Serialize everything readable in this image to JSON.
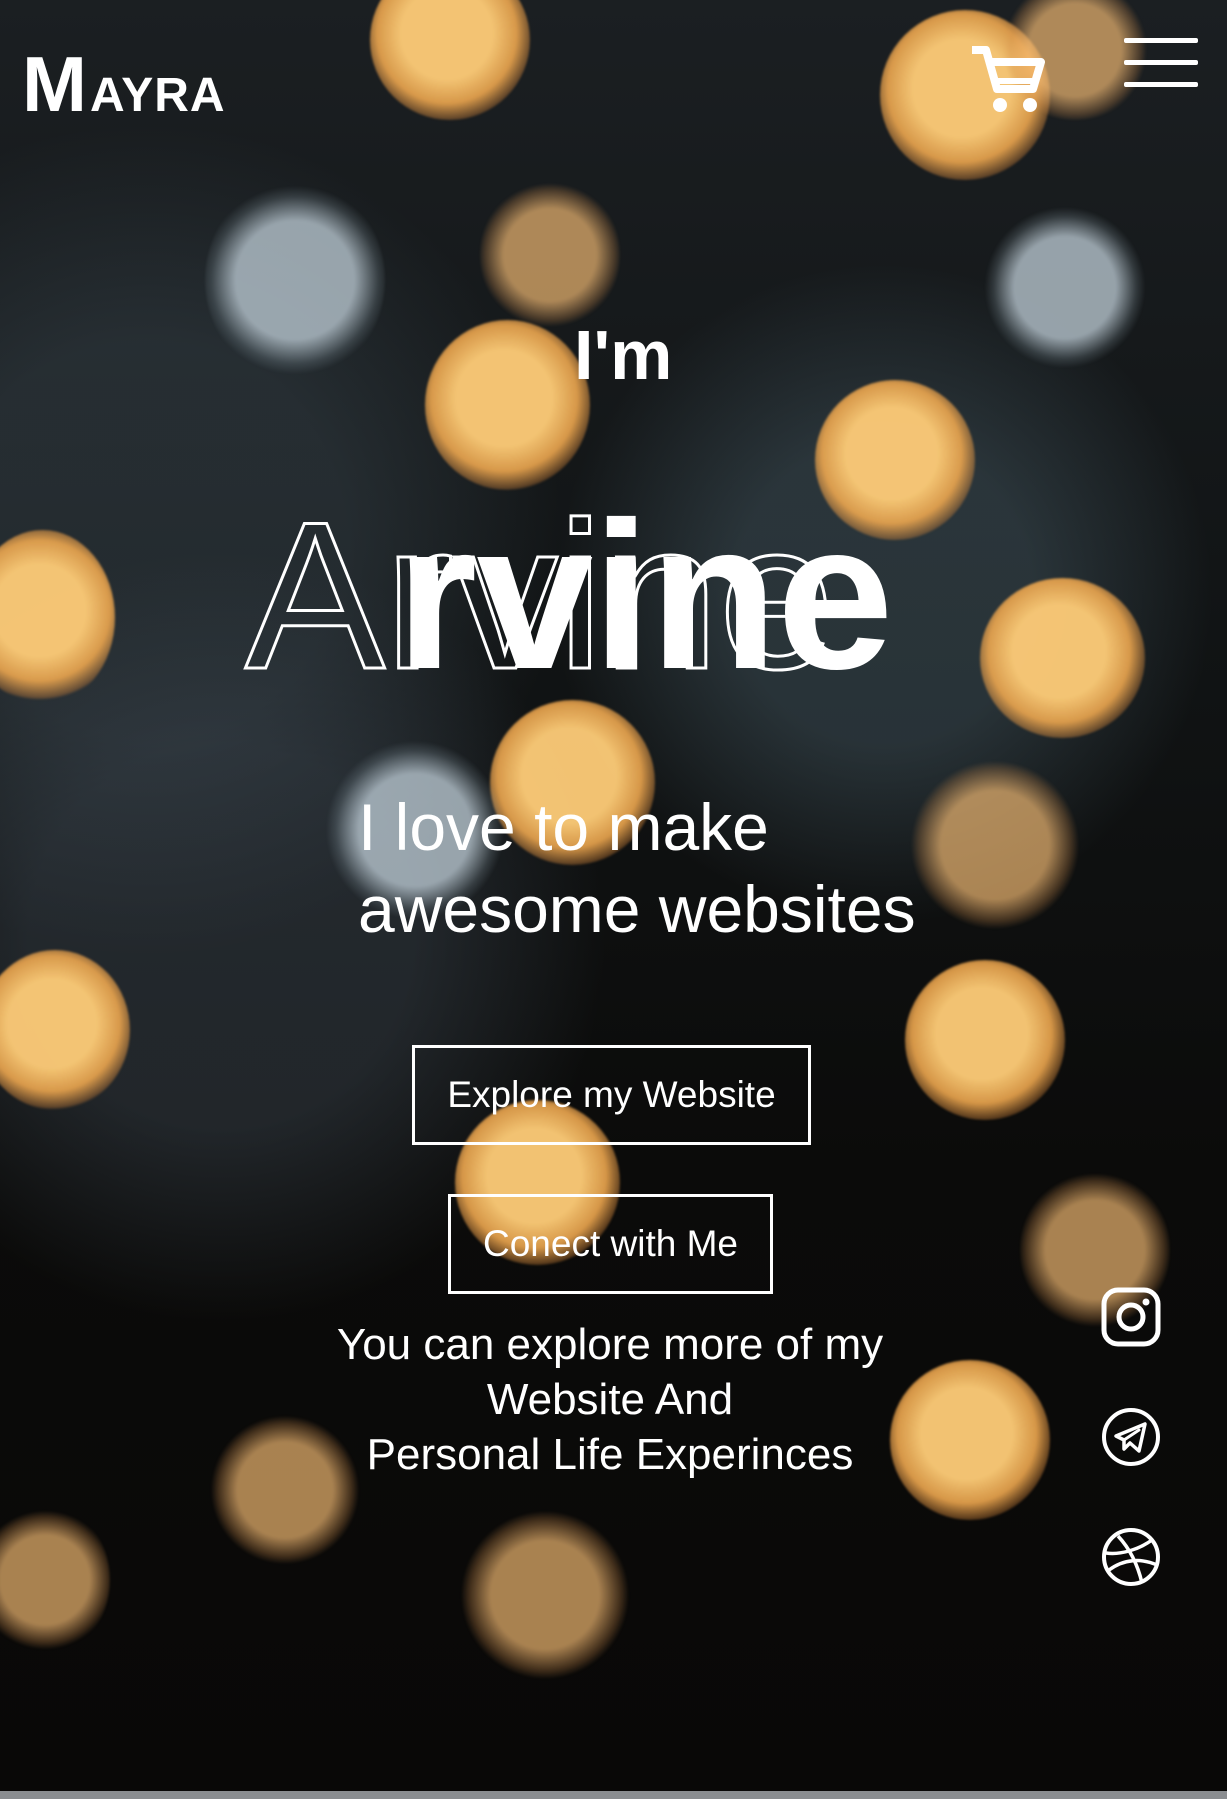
{
  "brand": {
    "initial": "M",
    "rest": "AYRA"
  },
  "header": {
    "cart_icon": "shopping-cart-icon",
    "menu_icon": "hamburger-menu-icon"
  },
  "hero": {
    "intro": "I'm",
    "name": "Arvine",
    "tagline_line1": "I love to make",
    "tagline_line2": "awesome websites"
  },
  "buttons": {
    "explore": "Explore my Website",
    "connect": "Conect with Me"
  },
  "blurb": {
    "line1": "You can explore more of my",
    "line2": "Website And",
    "line3": "Personal Life Experinces"
  },
  "social": [
    {
      "name": "instagram-icon"
    },
    {
      "name": "telegram-icon"
    },
    {
      "name": "dribbble-icon"
    }
  ],
  "colors": {
    "text": "#ffffff",
    "bokeh": "#f2b060",
    "background": "#0b0b0b"
  }
}
